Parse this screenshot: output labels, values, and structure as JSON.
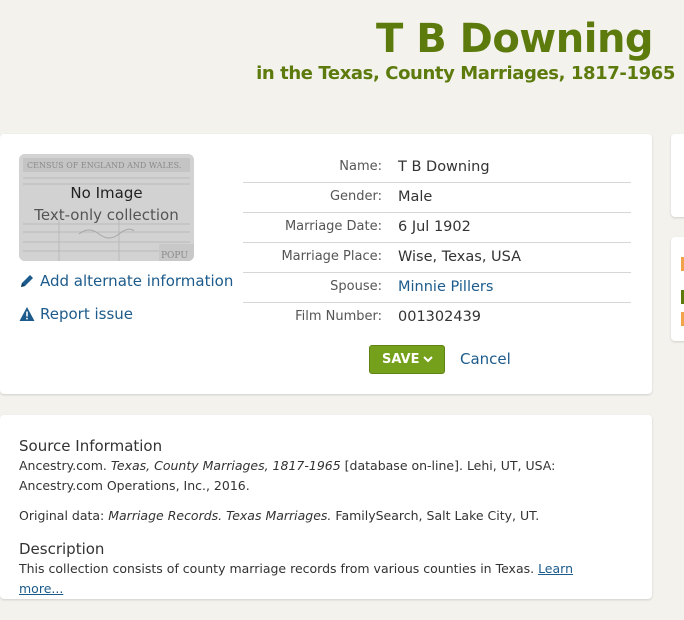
{
  "header": {
    "title": "T B Downing",
    "subtitle": "in the Texas, County Marriages, 1817-1965"
  },
  "thumbnail": {
    "line1": "No Image",
    "line2": "Text-only collection"
  },
  "actions": {
    "alt_info": "Add alternate information",
    "report": "Report issue"
  },
  "fields": [
    {
      "label": "Name:",
      "value": "T B Downing"
    },
    {
      "label": "Gender:",
      "value": "Male"
    },
    {
      "label": "Marriage Date:",
      "value": "6 Jul 1902"
    },
    {
      "label": "Marriage Place:",
      "value": "Wise, Texas, USA"
    },
    {
      "label": "Spouse:",
      "value": "Minnie Pillers"
    },
    {
      "label": "Film Number:",
      "value": "001302439"
    }
  ],
  "buttons": {
    "save": "SAVE",
    "cancel": "Cancel"
  },
  "source": {
    "heading": "Source Information",
    "citation_pre": "Ancestry.com. ",
    "citation_title": "Texas, County Marriages, 1817-1965",
    "citation_post": " [database on-line]. Lehi, UT, USA: Ancestry.com Operations, Inc., 2016.",
    "original_pre": "Original data: ",
    "original_title": "Marriage Records. Texas Marriages.",
    "original_post": " FamilySearch, Salt Lake City, UT.",
    "desc_heading": "Description",
    "desc_text": "This collection consists of county marriage records from various counties in Texas. ",
    "learn_more": "Learn more..."
  },
  "colors": {
    "brand_green": "#5d7a0d",
    "save_green": "#74a01b",
    "link_blue": "#1c5b8b",
    "background": "#f3f2ed"
  },
  "icons": [
    "pencil-icon",
    "warning-icon",
    "chevron-down-icon"
  ]
}
